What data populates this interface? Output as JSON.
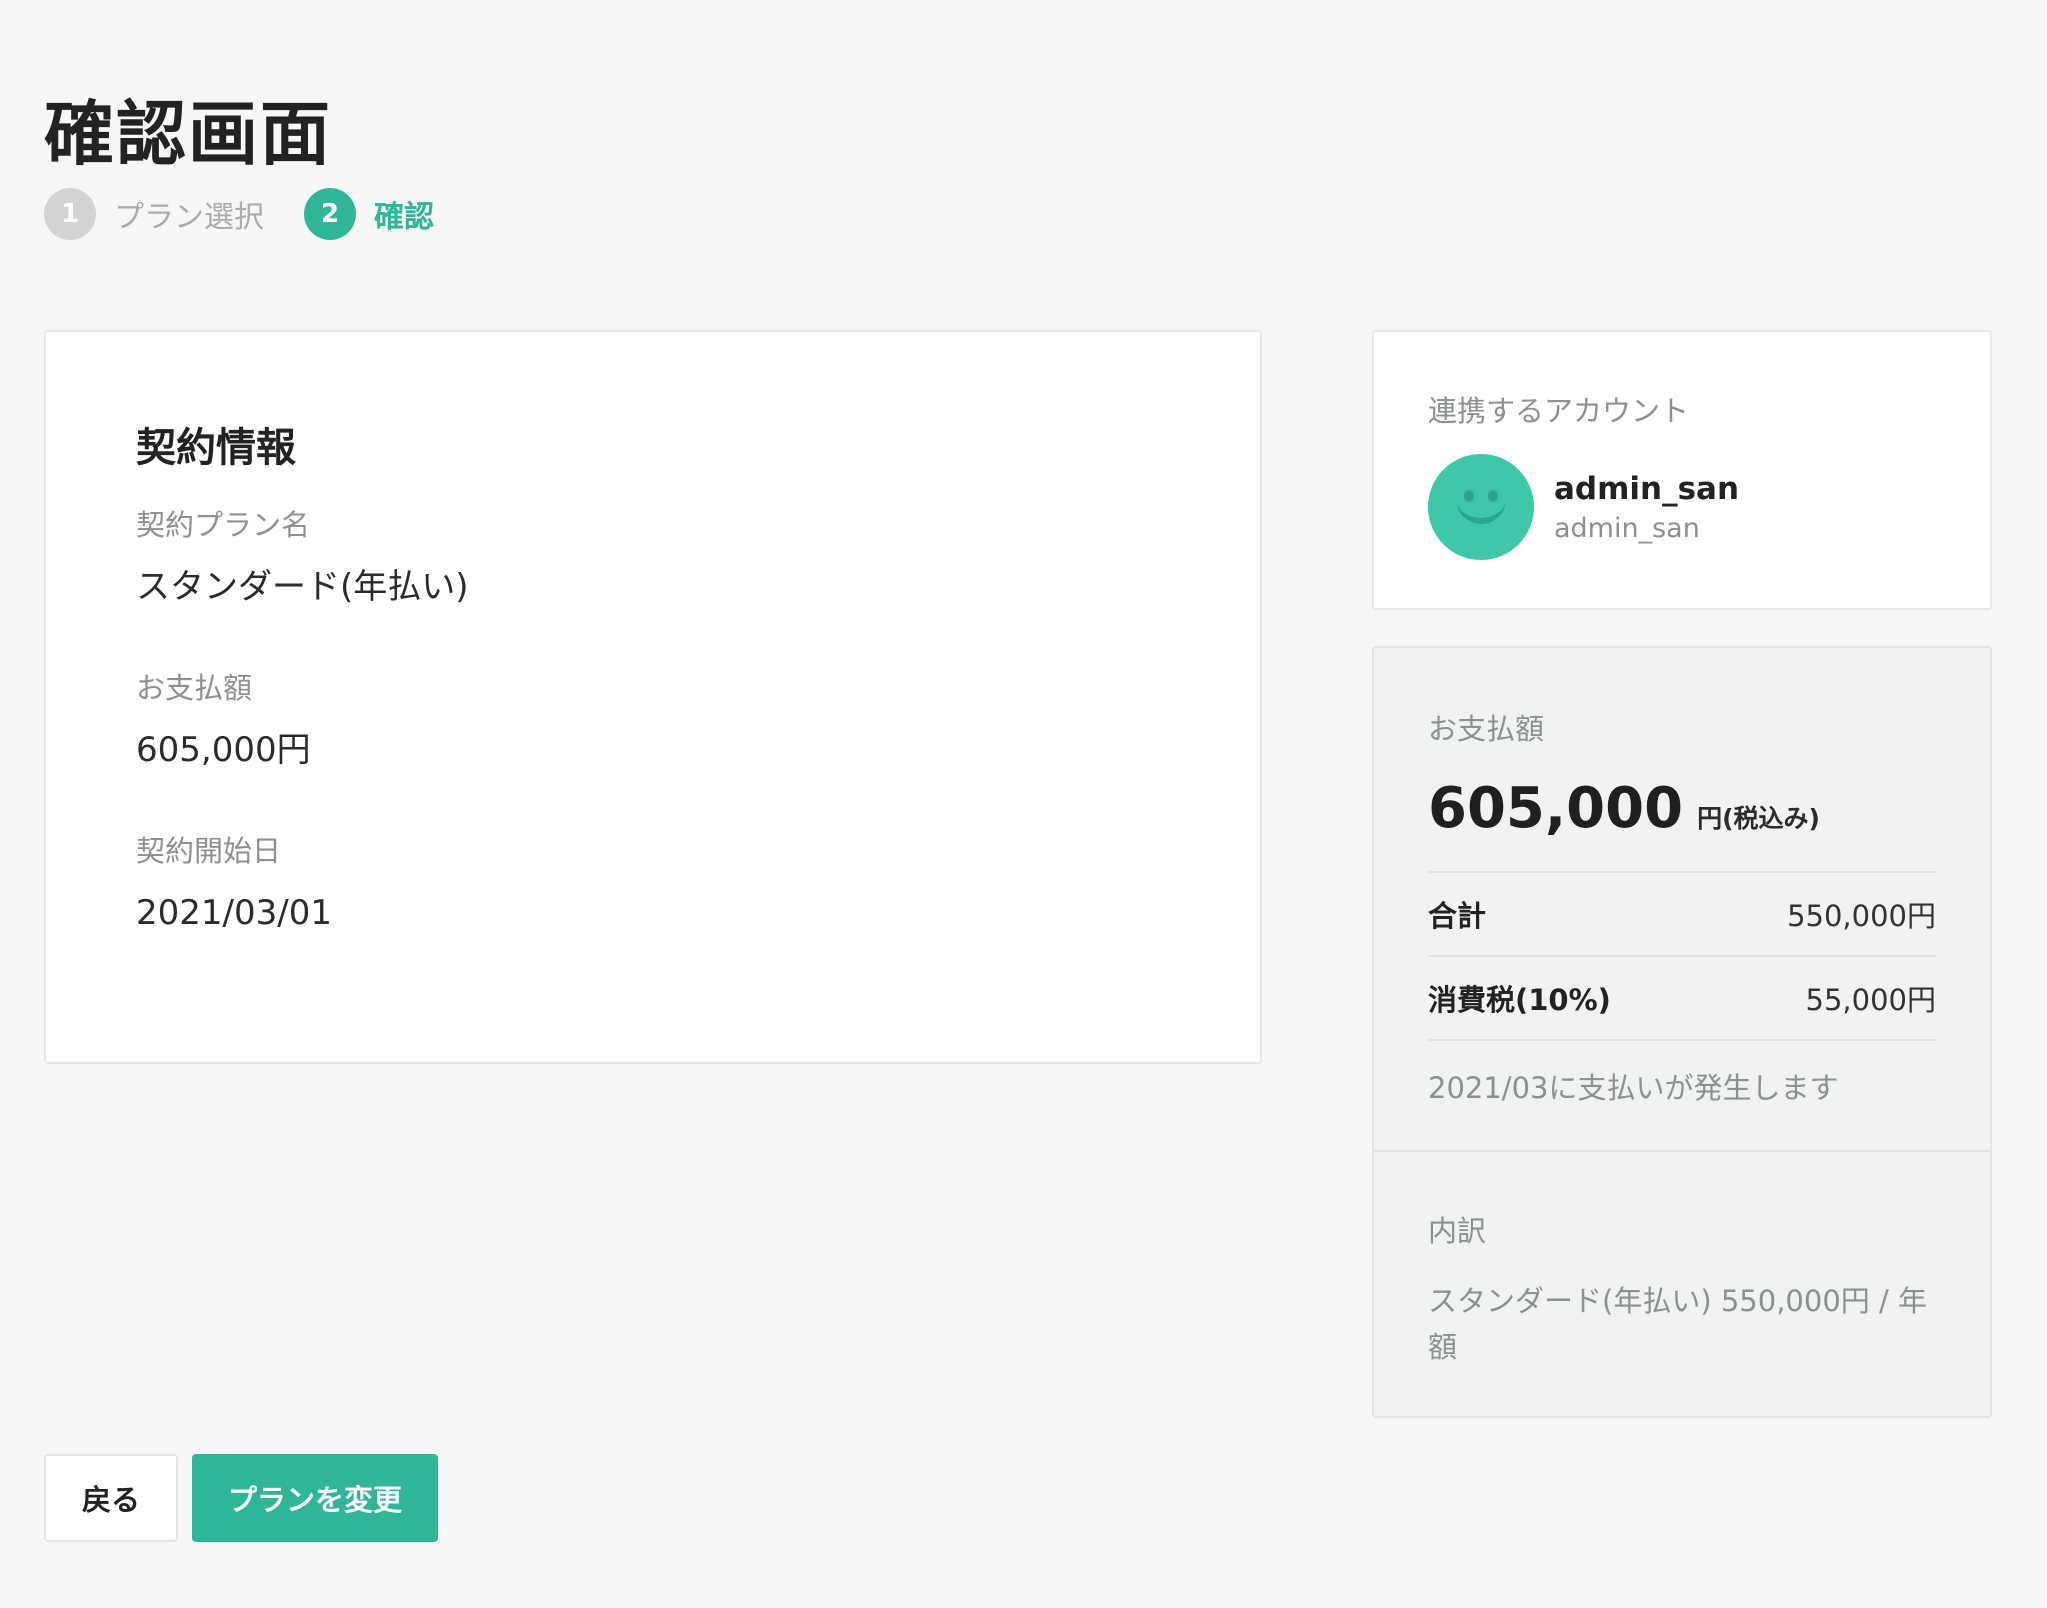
{
  "page": {
    "title": "確認画面"
  },
  "stepper": {
    "steps": [
      {
        "number": "1",
        "label": "プラン選択"
      },
      {
        "number": "2",
        "label": "確認"
      }
    ]
  },
  "contract": {
    "heading": "契約情報",
    "plan_label": "契約プラン名",
    "plan_value": "スタンダード(年払い)",
    "amount_label": "お支払額",
    "amount_value": "605,000円",
    "start_label": "契約開始日",
    "start_value": "2021/03/01"
  },
  "account": {
    "label": "連携するアカウント",
    "name": "admin_san",
    "id": "admin_san"
  },
  "payment": {
    "label": "お支払額",
    "total_number": "605,000",
    "total_unit": "円(税込み)",
    "subtotal_label": "合計",
    "subtotal_value": "550,000円",
    "tax_label": "消費税(10%)",
    "tax_value": "55,000円",
    "note": "2021/03に支払いが発生します",
    "breakdown_label": "内訳",
    "breakdown_text": "スタンダード(年払い) 550,000円 / 年額"
  },
  "actions": {
    "back_label": "戻る",
    "submit_label": "プランを変更"
  },
  "colors": {
    "accent": "#2fb597",
    "avatar": "#3fc7aa",
    "inactive_step": "#d3d5d4",
    "background": "#f6f7f6"
  }
}
